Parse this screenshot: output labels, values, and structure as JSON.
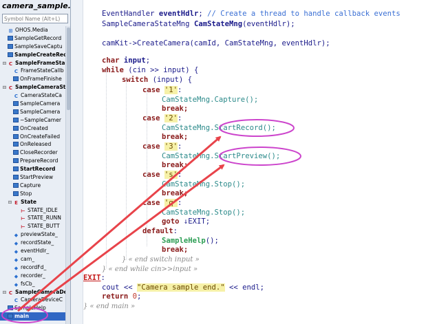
{
  "file_title": "camera_sample.cpp",
  "search": {
    "placeholder": "Symbol Name (Alt+L)"
  },
  "tree": [
    {
      "label": "OHOS.Media",
      "icon": "namespace",
      "ind": "",
      "bold": false
    },
    {
      "label": "SampleGetRecord",
      "icon": "function",
      "ind": "",
      "bold": false
    },
    {
      "label": "SampleSaveCaptu",
      "icon": "function",
      "ind": "",
      "bold": false
    },
    {
      "label": "SampleCreateRec",
      "icon": "function",
      "ind": "",
      "bold": true
    },
    {
      "label": "SampleFrameSta",
      "icon": "class",
      "ind": "⊟",
      "bold": true
    },
    {
      "label": "FrameStateCallb",
      "icon": "constructor",
      "ind": "",
      "bold": false
    },
    {
      "label": "OnFrameFinishe",
      "icon": "method",
      "ind": "",
      "bold": false
    },
    {
      "label": "SampleCameraSt",
      "icon": "class",
      "ind": "⊟",
      "bold": true
    },
    {
      "label": "CameraStateCa",
      "icon": "constructor",
      "ind": "",
      "bold": false
    },
    {
      "label": "SampleCamera",
      "icon": "method",
      "ind": "",
      "bold": false
    },
    {
      "label": "SampleCamera",
      "icon": "method",
      "ind": "",
      "bold": false
    },
    {
      "label": "~SampleCamer",
      "icon": "method",
      "ind": "",
      "bold": false
    },
    {
      "label": "OnCreated",
      "icon": "method",
      "ind": "",
      "bold": false
    },
    {
      "label": "OnCreateFailed",
      "icon": "method",
      "ind": "",
      "bold": false
    },
    {
      "label": "OnReleased",
      "icon": "method",
      "ind": "",
      "bold": false
    },
    {
      "label": "CloseRecorder",
      "icon": "method",
      "ind": "",
      "bold": false
    },
    {
      "label": "PrepareRecord",
      "icon": "method",
      "ind": "",
      "bold": false
    },
    {
      "label": "StartRecord",
      "icon": "method",
      "ind": "",
      "bold": true
    },
    {
      "label": "StartPreview",
      "icon": "method",
      "ind": "",
      "bold": false
    },
    {
      "label": "Capture",
      "icon": "method",
      "ind": "",
      "bold": false
    },
    {
      "label": "Stop",
      "icon": "method",
      "ind": "",
      "bold": false
    },
    {
      "label": "State",
      "icon": "enum",
      "ind": "⊟",
      "bold": true
    },
    {
      "label": "STATE_IDLE",
      "icon": "enum-member",
      "ind": "",
      "bold": false
    },
    {
      "label": "STATE_RUNN",
      "icon": "enum-member",
      "ind": "",
      "bold": false
    },
    {
      "label": "STATE_BUTT",
      "icon": "enum-member",
      "ind": "",
      "bold": false
    },
    {
      "label": "previewState_",
      "icon": "field",
      "ind": "",
      "bold": false
    },
    {
      "label": "recordState_",
      "icon": "field",
      "ind": "",
      "bold": false
    },
    {
      "label": "eventHdlr_",
      "icon": "field",
      "ind": "",
      "bold": false
    },
    {
      "label": "cam_",
      "icon": "field",
      "ind": "",
      "bold": false
    },
    {
      "label": "recordFd_",
      "icon": "field",
      "ind": "",
      "bold": false
    },
    {
      "label": "recorder_",
      "icon": "field",
      "ind": "",
      "bold": false
    },
    {
      "label": "fsCb_",
      "icon": "field",
      "ind": "",
      "bold": false
    },
    {
      "label": "SampleCameraDe",
      "icon": "class",
      "ind": "⊟",
      "bold": true
    },
    {
      "label": "CameraDeviceC",
      "icon": "constructor",
      "ind": "",
      "bold": false
    },
    {
      "label": "SampleHelp",
      "icon": "function",
      "ind": "",
      "bold": false
    },
    {
      "label": "main",
      "icon": "function",
      "ind": "",
      "bold": true,
      "selected": true
    }
  ],
  "code": {
    "l1": {
      "a": "EventHandler ",
      "b": "eventHdlr",
      "c": "; ",
      "d": "// Create a thread to handle callback events"
    },
    "l2": {
      "a": "SampleCameraStateMng ",
      "b": "CamStateMng",
      "c": "(eventHdlr);"
    },
    "l3": {
      "a": "camKit->CreateCamera(camId, CamStateMng, eventHdlr);"
    },
    "l4": {
      "a": "char ",
      "b": "input",
      "c": ";"
    },
    "l5": {
      "a": "while ",
      "b": "(cin >> input) {"
    },
    "l6": {
      "a": "switch ",
      "b": "(input) {"
    },
    "case1": {
      "kw": "case ",
      "val": "'1'",
      "col": ":"
    },
    "call1": "CamStateMng.Capture();",
    "break": "break;",
    "case2": {
      "kw": "case ",
      "val": "'2'",
      "col": ":"
    },
    "call2": {
      "a": "CamStateMng.",
      "b": "StartRecord();"
    },
    "case3": {
      "kw": "case ",
      "val": "'3'",
      "col": ":"
    },
    "call3": {
      "a": "CamStateMng.",
      "b": "StartPreview();"
    },
    "case4": {
      "kw": "case ",
      "val": "'s'",
      "col": ":"
    },
    "call4": "CamStateMng.Stop();",
    "case5": {
      "kw": "case ",
      "val": "'q'",
      "col": ":"
    },
    "call5": "CamStateMng.Stop();",
    "goto": {
      "kw": "goto ",
      "lab": "EXIT",
      "col": ";"
    },
    "default": {
      "kw": "default",
      "col": ":"
    },
    "help": "SampleHelp",
    "help_rest": "();",
    "end_switch": "} « end switch input »",
    "end_while": "} « end while cin>>input »",
    "exit_label": "EXIT",
    "exit_colon": ":",
    "cout": {
      "a": "cout << ",
      "s": "\"Camera sample end.\"",
      "b": " << endl;"
    },
    "ret": {
      "kw": "return ",
      "num": "0",
      "c": ";"
    },
    "end_main": "} « end main »"
  },
  "annotation_color": "#e8434a",
  "ellipse_color": "#cc44cc"
}
